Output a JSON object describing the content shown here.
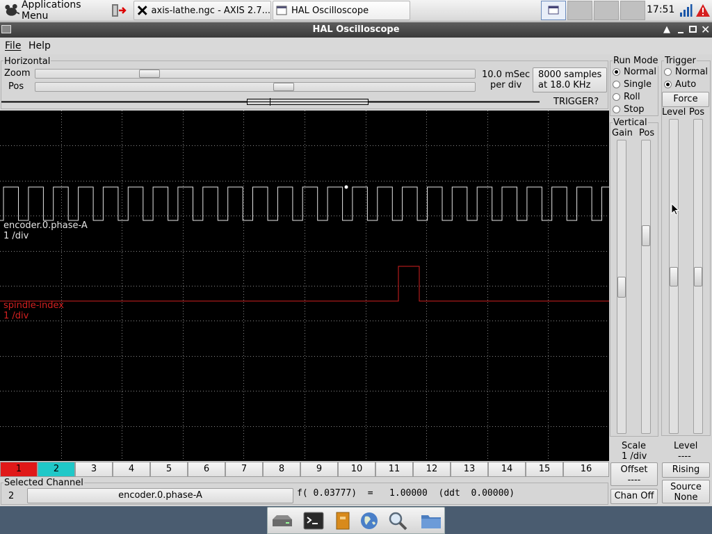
{
  "taskbar": {
    "apps_menu": "Applications Menu",
    "tasks": [
      {
        "label": "axis-lathe.ngc - AXIS 2.7..."
      },
      {
        "label": "HAL Oscilloscope"
      }
    ],
    "clock": "17:51"
  },
  "window": {
    "title": "HAL Oscilloscope"
  },
  "menu": {
    "file": "File",
    "help": "Help"
  },
  "horizontal": {
    "title": "Horizontal",
    "zoom_label": "Zoom",
    "pos_label": "Pos",
    "timebase_line1": "10.0 mSec",
    "timebase_line2": "per div",
    "samples_line1": "8000 samples",
    "samples_line2": "at 18.0 KHz",
    "trigger_status": "TRIGGER?"
  },
  "run_mode": {
    "title": "Run Mode",
    "options": [
      "Normal",
      "Single",
      "Roll",
      "Stop"
    ],
    "selected": "Normal"
  },
  "trigger": {
    "title": "Trigger",
    "options": [
      "Normal",
      "Auto"
    ],
    "selected": "Auto",
    "force": "Force",
    "level_label": "Level",
    "pos_label": "Pos",
    "level_title": "Level",
    "level_value": "----",
    "edge": "Rising",
    "source_label": "Source",
    "source_value": "None"
  },
  "vertical": {
    "title": "Vertical",
    "gain_label": "Gain",
    "pos_label": "Pos",
    "scale_label": "Scale",
    "scale_value": "1 /div",
    "offset_label": "Offset",
    "offset_value": "----",
    "chan_off": "Chan Off"
  },
  "traces": [
    {
      "name": "encoder.0.phase-A",
      "scale": "1 /div",
      "color": "#e6e6e6"
    },
    {
      "name": "spindle-index",
      "scale": "1 /div",
      "color": "#d42020"
    }
  ],
  "channels": [
    "1",
    "2",
    "3",
    "4",
    "5",
    "6",
    "7",
    "8",
    "9",
    "10",
    "11",
    "12",
    "13",
    "14",
    "15",
    "16"
  ],
  "channel_colors": {
    "1": "#e01818",
    "2": "#20c8c8"
  },
  "selected_channel": {
    "title": "Selected Channel",
    "number": "2",
    "name": "encoder.0.phase-A",
    "readout": "f( 0.03777)  =   1.00000  (ddt  0.00000)"
  },
  "dock": {
    "icons": [
      "drive-icon",
      "terminal-icon",
      "file-manager-icon",
      "browser-icon",
      "search-icon",
      "folder-icon"
    ]
  }
}
